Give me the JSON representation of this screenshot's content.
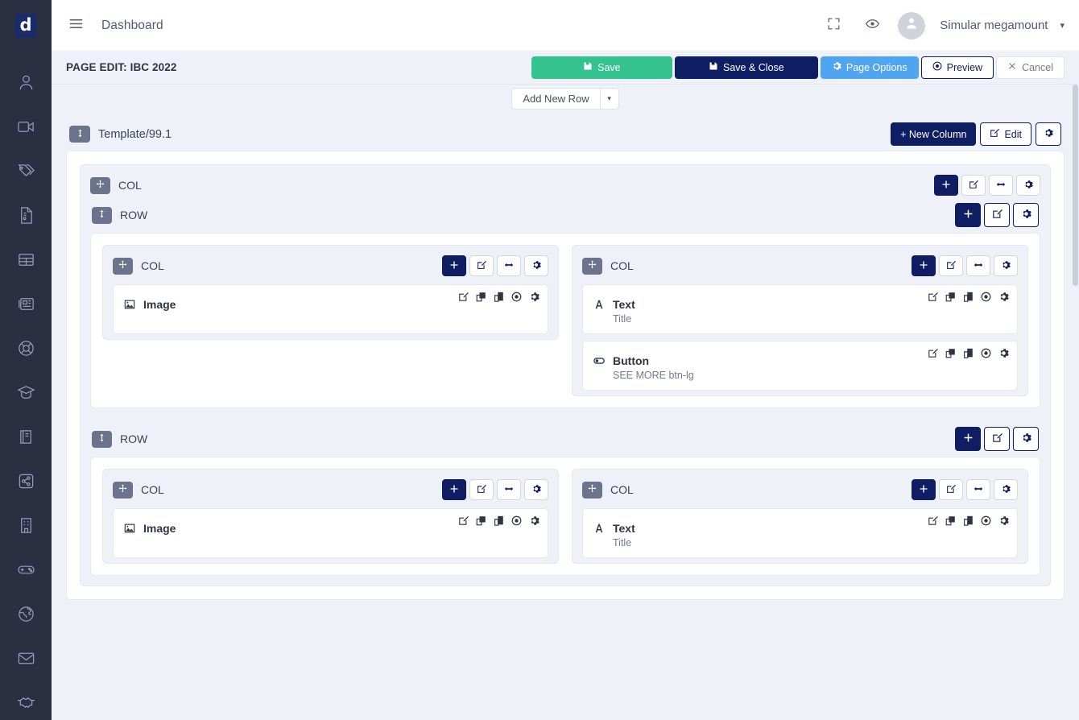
{
  "brand": {
    "logo_text": "d"
  },
  "sidebar": {
    "items": [
      {
        "name": "user-icon",
        "label": "Users"
      },
      {
        "name": "video-icon",
        "label": "Videos"
      },
      {
        "name": "tags-icon",
        "label": "Tags"
      },
      {
        "name": "document-icon",
        "label": "Documents"
      },
      {
        "name": "table-icon",
        "label": "Tables"
      },
      {
        "name": "newspaper-icon",
        "label": "News"
      },
      {
        "name": "lifebuoy-icon",
        "label": "Support"
      },
      {
        "name": "graduation-cap-icon",
        "label": "Education"
      },
      {
        "name": "book-icon",
        "label": "Library"
      },
      {
        "name": "share-nodes-icon",
        "label": "Share"
      },
      {
        "name": "building-icon",
        "label": "Company"
      },
      {
        "name": "gamepad-icon",
        "label": "Games"
      },
      {
        "name": "globe-icon",
        "label": "Global"
      },
      {
        "name": "envelope-icon",
        "label": "Mail"
      },
      {
        "name": "handshake-icon",
        "label": "Partners"
      }
    ]
  },
  "topbar": {
    "title": "Dashboard",
    "fullscreen_label": "Fullscreen",
    "preview_eye_label": "Preview",
    "user_name": "Simular megamount",
    "caret": "⌄"
  },
  "pagebar": {
    "title": "PAGE EDIT: IBC 2022",
    "buttons": [
      {
        "label": "Save",
        "style": "save"
      },
      {
        "label": "Save & Close",
        "style": "saveclose"
      },
      {
        "label": "Page Options",
        "style": "options"
      },
      {
        "label": "Preview",
        "style": "preview"
      },
      {
        "label": "Cancel",
        "style": "cancel"
      }
    ]
  },
  "canvas": {
    "add_new_row": "Add New Row",
    "template": {
      "label": "Template/99.1",
      "new_column": "+ New Column",
      "edit": "Edit"
    },
    "labels": {
      "col": "COL",
      "row": "ROW"
    },
    "widgets": {
      "image": {
        "title": "Image",
        "subtitle": ""
      },
      "text": {
        "title": "Text",
        "subtitle": "Title"
      },
      "button": {
        "title": "Button",
        "subtitle": "SEE MORE btn-lg"
      }
    }
  },
  "colors": {
    "brand_navy": "#0f1d63",
    "sidebar_bg": "#2a3042",
    "save_green": "#34c38f",
    "options_blue": "#50a5f1",
    "canvas_bg": "#eef1f7",
    "handle_gray": "#6c748d"
  }
}
